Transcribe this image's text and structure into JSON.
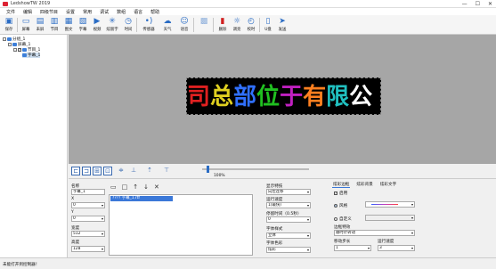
{
  "window": {
    "title": "LedshowTW 2019",
    "buttons": [
      "—",
      "☐",
      "✕"
    ]
  },
  "menu": [
    "文件",
    "编辑",
    "四级节目",
    "设置",
    "常用",
    "调试",
    "数组",
    "语言",
    "帮助"
  ],
  "toolbar": [
    {
      "label": "保存",
      "icon": "save-icon"
    },
    {
      "label": "屏幕",
      "icon": "screen-icon"
    },
    {
      "label": "未屏",
      "icon": "screen2-icon"
    },
    {
      "label": "节目",
      "icon": "program-icon"
    },
    {
      "label": "图文",
      "icon": "image-text-icon"
    },
    {
      "label": "字幕",
      "icon": "subtitle-icon"
    },
    {
      "label": "视频",
      "icon": "video-icon"
    },
    {
      "label": "炫丽字",
      "icon": "fancy-text-icon"
    },
    {
      "label": "时间",
      "icon": "clock-icon"
    },
    {
      "label": "传感器",
      "icon": "sensor-icon"
    },
    {
      "label": "天气",
      "icon": "weather-icon"
    },
    {
      "label": "语音",
      "icon": "voice-icon"
    },
    {
      "label": "删除",
      "icon": "delete-icon"
    },
    {
      "label": "调亮",
      "icon": "brightness-icon"
    },
    {
      "label": "校时",
      "icon": "timesync-icon"
    },
    {
      "label": "U盘",
      "icon": "usb-icon"
    },
    {
      "label": "发送",
      "icon": "send-icon"
    }
  ],
  "tree": {
    "root": "分组_1",
    "screen": "屏幕_1",
    "program": "节目_1",
    "area": "字幕_1"
  },
  "screen_text": "司总部位于有限公",
  "screen_colors": [
    "#e02020",
    "#e0d020",
    "#3070ff",
    "#20c020",
    "#c020c0",
    "#ff8020",
    "#20c0c0",
    "#ffffff"
  ],
  "zoom": "100%",
  "props": {
    "name_label": "名称",
    "name_value": "字幕_1",
    "x_label": "X",
    "x_value": "0",
    "y_label": "Y",
    "y_value": "0",
    "width_label": "宽度",
    "width_value": "512",
    "height_label": "高度",
    "height_value": "128",
    "list_item": "???? 字幕_1.rtf"
  },
  "effects": {
    "display_label": "显示特技",
    "display_value": "向左连移",
    "speed_label": "运行速度",
    "speed_value": "1(最快)",
    "stay_label": "停留时间（0.5秒）",
    "stay_value": "0",
    "font_style_label": "字体样式",
    "font_style_value": "立体",
    "font_color_label": "字体色彩",
    "font_color_value": "炫彩"
  },
  "border": {
    "tabs": [
      "炫彩边框",
      "炫彩背景",
      "炫彩文字"
    ],
    "enable_label": "启用",
    "style_label": "风格",
    "custom_label": "自定义",
    "effect_label": "边框特效",
    "effect_value": "顺时针转动",
    "step_label": "移动步长",
    "step_value": "1",
    "speed_label": "运行速度",
    "speed_value": "3"
  },
  "status": "未能打开到控制器！"
}
